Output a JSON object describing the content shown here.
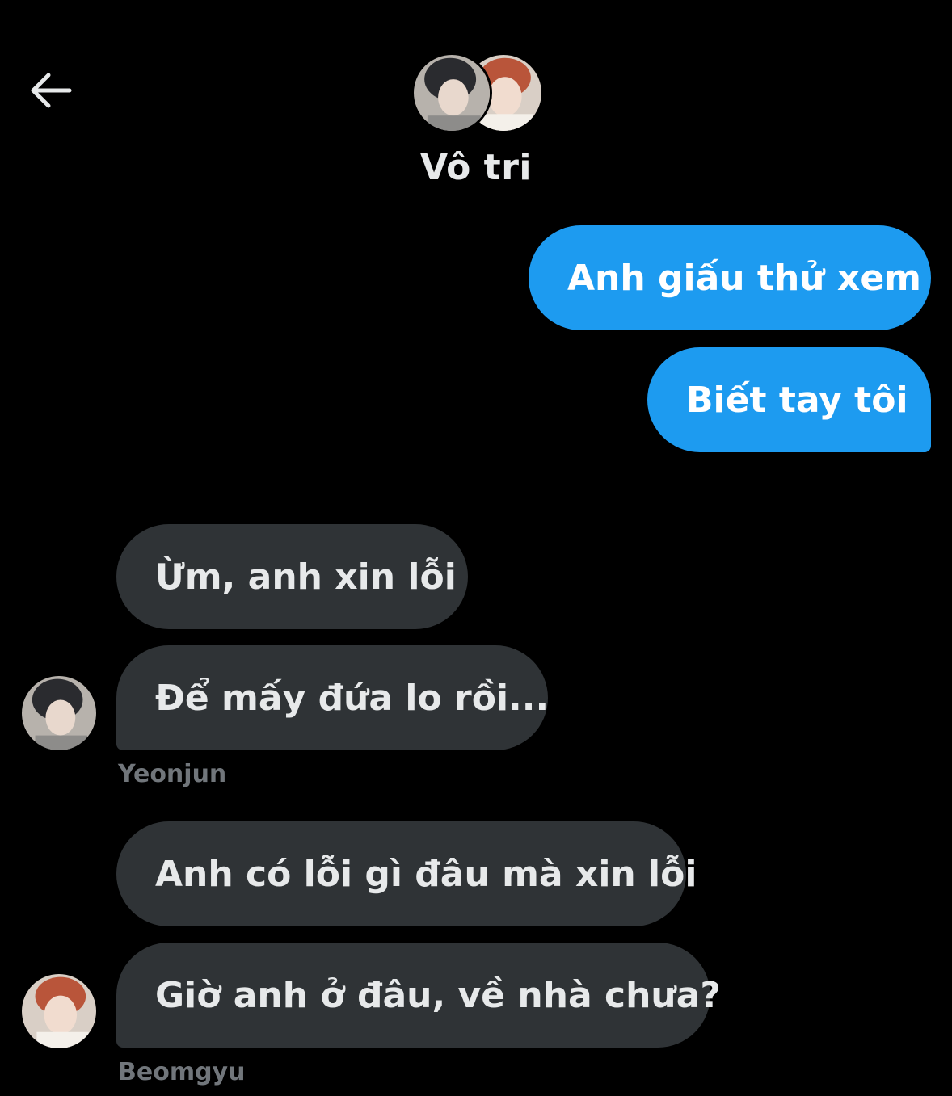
{
  "header": {
    "back_icon": "arrow-left-icon",
    "title": "Vô tri",
    "participants": [
      "Yeonjun",
      "Beomgyu"
    ]
  },
  "messages": {
    "outgoing": [
      {
        "text": "Anh giấu thử xem"
      },
      {
        "text": "Biết tay tôi"
      }
    ],
    "groups": [
      {
        "sender": "Yeonjun",
        "texts": [
          "Ừm, anh xin lỗi",
          "Để mấy đứa lo rồi..."
        ]
      },
      {
        "sender": "Beomgyu",
        "texts": [
          "Anh có lỗi gì đâu mà xin lỗi",
          "Giờ anh ở đâu, về nhà chưa?"
        ]
      }
    ]
  },
  "colors": {
    "background": "#000000",
    "outgoing_bubble": "#1d9bf0",
    "incoming_bubble": "#2f3336",
    "sender_name": "#71767b"
  }
}
